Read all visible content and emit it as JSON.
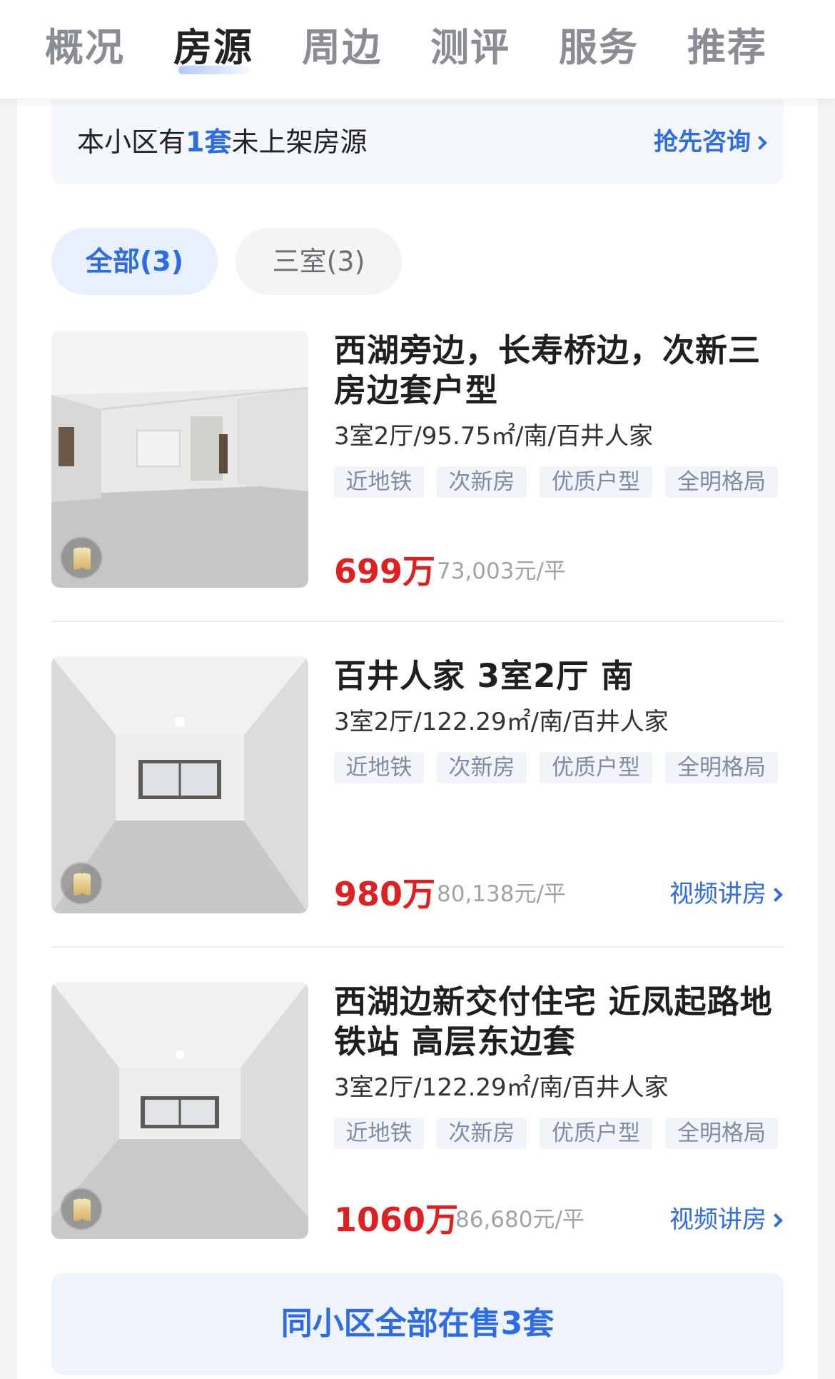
{
  "tabs": [
    {
      "label": "概况",
      "active": false
    },
    {
      "label": "房源",
      "active": true
    },
    {
      "label": "周边",
      "active": false
    },
    {
      "label": "测评",
      "active": false
    },
    {
      "label": "服务",
      "active": false
    },
    {
      "label": "推荐",
      "active": false
    }
  ],
  "notice": {
    "prefix": "本小区有",
    "count": "1套",
    "suffix": "未上架房源",
    "link_label": "抢先咨询"
  },
  "filters": [
    {
      "label": "全部(3)",
      "active": true
    },
    {
      "label": "三室(3)",
      "active": false
    }
  ],
  "listings": [
    {
      "title": "西湖旁边，长寿桥边，次新三房边套户型",
      "specs": "3室2厅/95.75㎡/南/百井人家",
      "tags": [
        "近地铁",
        "次新房",
        "优质户型",
        "全明格局"
      ],
      "price": "699万",
      "unit_price": "73,003元/平",
      "video_label": ""
    },
    {
      "title": "百井人家 3室2厅 南",
      "specs": "3室2厅/122.29㎡/南/百井人家",
      "tags": [
        "近地铁",
        "次新房",
        "优质户型",
        "全明格局"
      ],
      "price": "980万",
      "unit_price": "80,138元/平",
      "video_label": "视频讲房"
    },
    {
      "title": "西湖边新交付住宅 近凤起路地铁站 高层东边套",
      "specs": "3室2厅/122.29㎡/南/百井人家",
      "tags": [
        "近地铁",
        "次新房",
        "优质户型",
        "全明格局"
      ],
      "price": "1060万",
      "unit_price": "86,680元/平",
      "video_label": "视频讲房"
    }
  ],
  "all_button_label": "同小区全部在售3套",
  "colors": {
    "accent": "#2e6be6",
    "price": "#e02020",
    "tag_bg": "#f1f4f8",
    "tag_text": "#7e8da3"
  }
}
